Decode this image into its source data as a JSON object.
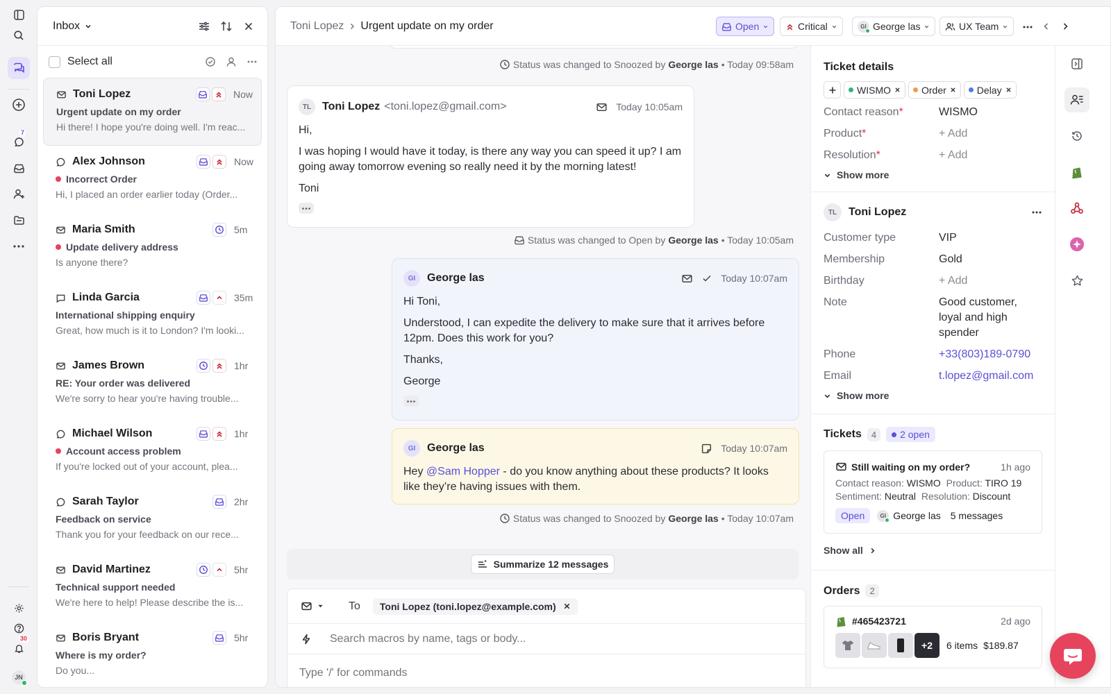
{
  "rail": {
    "conversations_badge": "7",
    "notifications_badge": "30",
    "avatar_initials": "JN"
  },
  "inbox": {
    "title": "Inbox",
    "select_all_label": "Select all",
    "conversations": [
      {
        "name": "Toni Lopez",
        "channel": "email",
        "subject": "Urgent update on my order",
        "preview": "Hi there! I hope you're doing well. I'm reac...",
        "time": "Now",
        "priority": "critical",
        "status": "open",
        "unread": false,
        "active": true
      },
      {
        "name": "Alex Johnson",
        "channel": "chat",
        "subject": "Incorrect Order",
        "preview": "Hi, I placed an order earlier today (Order...",
        "time": "Now",
        "priority": "critical",
        "status": "open",
        "unread": true,
        "active": false
      },
      {
        "name": "Maria Smith",
        "channel": "email",
        "subject": "Update delivery address",
        "preview": "Is anyone there?",
        "time": "5m",
        "priority": "",
        "status": "snoozed",
        "unread": true,
        "active": false
      },
      {
        "name": "Linda Garcia",
        "channel": "sms",
        "subject": "International shipping enquiry",
        "preview": "Great, how much is it to London? I'm looki...",
        "time": "35m",
        "priority": "medium",
        "status": "open",
        "unread": false,
        "active": false
      },
      {
        "name": "James Brown",
        "channel": "email",
        "subject": "RE: Your order was delivered",
        "preview": "We're sorry to hear you're having trouble...",
        "time": "1hr",
        "priority": "critical",
        "status": "snoozed",
        "unread": false,
        "active": false
      },
      {
        "name": "Michael Wilson",
        "channel": "chat",
        "subject": "Account access problem",
        "preview": "If you're locked out of your account, plea...",
        "time": "1hr",
        "priority": "critical",
        "status": "open",
        "unread": true,
        "active": false
      },
      {
        "name": "Sarah Taylor",
        "channel": "chat",
        "subject": "Feedback on service",
        "preview": "Thank you for your feedback on our rece...",
        "time": "2hr",
        "priority": "",
        "status": "open",
        "unread": false,
        "active": false
      },
      {
        "name": "David Martinez",
        "channel": "email",
        "subject": "Technical support needed",
        "preview": "We're here to help! Please describe the is...",
        "time": "5hr",
        "priority": "medium",
        "status": "snoozed",
        "unread": false,
        "active": false
      },
      {
        "name": "Boris Bryant",
        "channel": "email",
        "subject": "Where is my order?",
        "preview": "Do you...",
        "time": "5hr",
        "priority": "",
        "status": "open",
        "unread": false,
        "active": false
      }
    ]
  },
  "header": {
    "breadcrumb_customer": "Toni Lopez",
    "breadcrumb_ticket": "Urgent update on my order",
    "status": "Open",
    "priority": "Critical",
    "assignee": "George las",
    "assignee_initials": "GI",
    "team": "UX Team"
  },
  "thread": {
    "sys1": {
      "text": "Status was changed to Snoozed by",
      "actor": "George las",
      "time": "• Today 09:58am"
    },
    "msg1": {
      "initials": "TL",
      "name": "Toni Lopez",
      "email": "<toni.lopez@gmail.com>",
      "time": "Today 10:05am",
      "lines": [
        "Hi,",
        "I was hoping I would have it today, is there any way you can speed it up? I am going away tomorrow evening so really need it by the morning latest!",
        "Toni"
      ]
    },
    "sys2": {
      "text": "Status was changed to Open by",
      "actor": "George las",
      "time": "• Today 10:05am"
    },
    "msg2": {
      "initials": "GI",
      "name": "George las",
      "time": "Today 10:07am",
      "lines": [
        "Hi Toni,",
        "Understood, I can expedite the delivery to make sure that it arrives before 12pm. Does this work for you?",
        "Thanks,",
        "George"
      ]
    },
    "note": {
      "initials": "GI",
      "name": "George las",
      "time": "Today 10:07am",
      "before": "Hey ",
      "mention": "@Sam Hopper",
      "after": " - do you know anything about these products? It looks like they’re having issues with them."
    },
    "sys3": {
      "text": "Status was changed to Snoozed by",
      "actor": "George las",
      "time": "• Today 10:07am"
    },
    "summarize_label": "Summarize 12 messages"
  },
  "composer": {
    "to_label": "To",
    "recipient": "Toni Lopez (toni.lopez@example.com)",
    "macro_placeholder": "Search macros by name, tags or body...",
    "body_placeholder": "Type '/' for commands"
  },
  "ticket_details": {
    "title": "Ticket details",
    "tags": [
      {
        "label": "WISMO",
        "color": "#2fb57a"
      },
      {
        "label": "Order",
        "color": "#f29a4a"
      },
      {
        "label": "Delay",
        "color": "#4d7ce8"
      }
    ],
    "fields": [
      {
        "key": "Contact reason",
        "value": "WISMO"
      },
      {
        "key": "Product",
        "value": "+ Add"
      },
      {
        "key": "Resolution",
        "value": "+ Add"
      }
    ],
    "show_more": "Show more"
  },
  "customer": {
    "initials": "TL",
    "name": "Toni Lopez",
    "fields": [
      {
        "key": "Customer type",
        "value": "VIP"
      },
      {
        "key": "Membership",
        "value": "Gold"
      },
      {
        "key": "Birthday",
        "value": "+ Add"
      },
      {
        "key": "Note",
        "value": "Good customer, loyal and high spender"
      },
      {
        "key": "Phone",
        "value": "+33(803)189-0790"
      },
      {
        "key": "Email",
        "value": "t.lopez@gmail.com"
      }
    ],
    "show_more": "Show more"
  },
  "tickets": {
    "title": "Tickets",
    "count": "4",
    "open_count": "2 open",
    "card": {
      "title": "Still waiting on my order?",
      "time": "1h ago",
      "contact_reason_key": "Contact reason:",
      "contact_reason": "WISMO",
      "product_key": "Product:",
      "product": "TIRO 19",
      "sentiment_key": "Sentiment:",
      "sentiment": "Neutral",
      "resolution_key": "Resolution:",
      "resolution": "Discount",
      "status": "Open",
      "assignee_initials": "GI",
      "assignee": "George las",
      "messages": "5 messages"
    },
    "show_all": "Show all"
  },
  "orders": {
    "title": "Orders",
    "count": "2",
    "order_id": "#465423721",
    "time": "2d ago",
    "more_items": "+2",
    "items": "6 items",
    "total": "$189.87"
  },
  "colors": {
    "accent": "#5b4fd6",
    "critical": "#c8283f",
    "note_bg": "#fdf8e6",
    "fab": "#e5445c"
  }
}
